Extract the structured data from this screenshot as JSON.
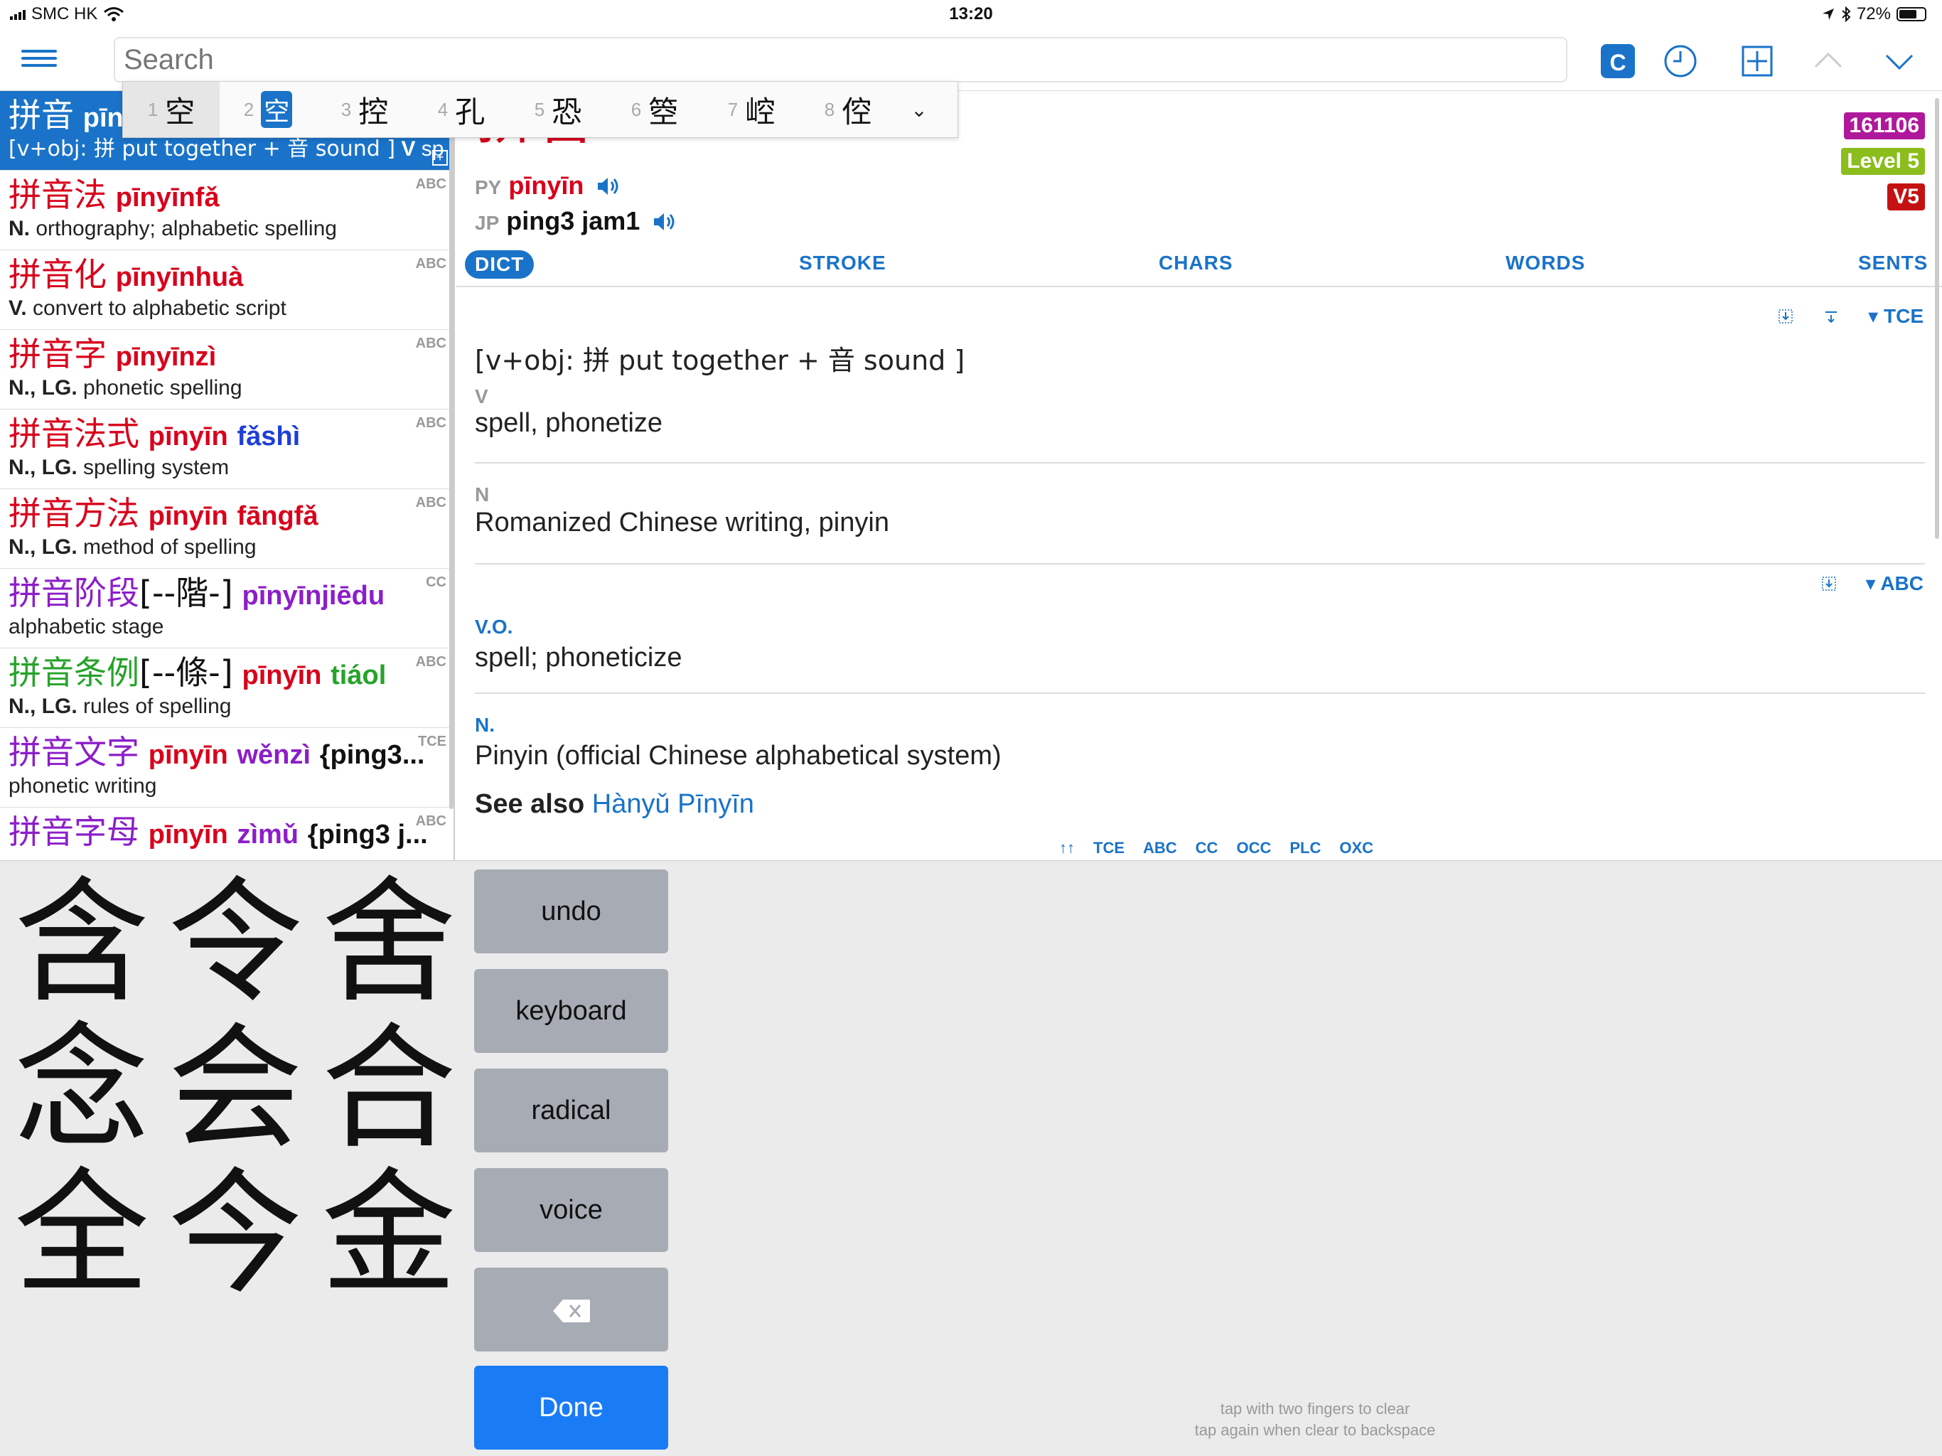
{
  "status": {
    "carrier": "SMC HK",
    "time": "13:20",
    "battery": "72%",
    "battery_level": 0.72
  },
  "search": {
    "placeholder": "Search"
  },
  "toolbar": {
    "c_label": "C"
  },
  "candidates": [
    {
      "n": "1",
      "ch": "空"
    },
    {
      "n": "2",
      "ch": "空"
    },
    {
      "n": "3",
      "ch": "控"
    },
    {
      "n": "4",
      "ch": "孔"
    },
    {
      "n": "5",
      "ch": "恐"
    },
    {
      "n": "6",
      "ch": "箜"
    },
    {
      "n": "7",
      "ch": "崆"
    },
    {
      "n": "8",
      "ch": "倥"
    }
  ],
  "list": {
    "r0": {
      "hz": "拼音",
      "py": "pīn",
      "def": "[v+obj: 拼 put together + 音 sound ]",
      "pos": "V",
      "def2": "sp..."
    },
    "r1": {
      "src": "ABC",
      "hz": "拼音法",
      "py": "pīnyīnfǎ",
      "pos": "N.",
      "def": "orthography; alphabetic spelling"
    },
    "r2": {
      "src": "ABC",
      "hz": "拼音化",
      "py": "pīnyīnhuà",
      "pos": "V.",
      "def": "convert to alphabetic script"
    },
    "r3": {
      "src": "ABC",
      "hz": "拼音字",
      "py": "pīnyīnzì",
      "pos": "N., LG.",
      "def": "phonetic spelling"
    },
    "r4": {
      "src": "ABC",
      "hz": "拼音法式",
      "py1": "pīnyīn",
      "py2": "fǎshì",
      "pos": "N., LG.",
      "def": "spelling system"
    },
    "r5": {
      "src": "ABC",
      "hz": "拼音方法",
      "py1": "pīnyīn",
      "py2": "fāngfǎ",
      "pos": "N., LG.",
      "def": "method of spelling"
    },
    "r6": {
      "src": "CC",
      "hz": "拼音阶段",
      "trad": "[--階-]",
      "py": "pīnyīnjiēdu",
      "def": "alphabetic stage"
    },
    "r7": {
      "src": "ABC",
      "hz": "拼音条例",
      "trad": "[--條-]",
      "py1": "pīnyīn",
      "py2": "tiáol",
      "pos": "N., LG.",
      "def": "rules of spelling"
    },
    "r8": {
      "src": "TCE",
      "hz": "拼音文字",
      "py1": "pīnyīn",
      "py2": "wěnzì",
      "jp": "{ping3...",
      "def": "phonetic writing"
    },
    "r9": {
      "src": "ABC",
      "hz": "拼音字母",
      "py1": "pīnyīn",
      "py2": "zìmǔ",
      "jp": "{ping3 j..."
    }
  },
  "entry": {
    "headword": "拼音",
    "py_label": "PY",
    "py": "pīnyīn",
    "jp_label": "JP",
    "jp": "ping3 jam1",
    "badge_num": "161106",
    "badge_level": "Level 5",
    "badge_v": "V5"
  },
  "tabs": {
    "dict": "DICT",
    "stroke": "STROKE",
    "chars": "CHARS",
    "words": "WORDS",
    "sents": "SENTS"
  },
  "sections": {
    "tce": {
      "label": "▾ TCE",
      "etym": "[v+obj: 拼 put together + 音 sound ]",
      "pos1": "V",
      "def1": "spell, phonetize",
      "pos2": "N",
      "def2": "Romanized Chinese writing, pinyin"
    },
    "abc": {
      "label": "▾ ABC",
      "pos1": "V.O.",
      "def1": "spell; phoneticize",
      "pos2": "N.",
      "def2": "Pinyin (official Chinese alphabetical system)",
      "see_also_label": "See also",
      "see_also_link": "Hànyǔ Pīnyīn"
    }
  },
  "footer_links": [
    "↑↑",
    "TCE",
    "ABC",
    "CC",
    "OCC",
    "PLC",
    "OXC"
  ],
  "handwriting": {
    "chars": [
      "含",
      "令",
      "舍",
      "念",
      "会",
      "合",
      "全",
      "今",
      "金"
    ],
    "undo": "undo",
    "keyboard": "keyboard",
    "radical": "radical",
    "voice": "voice",
    "done": "Done",
    "hint1": "tap with two fingers to clear",
    "hint2": "tap again when clear to backspace"
  }
}
